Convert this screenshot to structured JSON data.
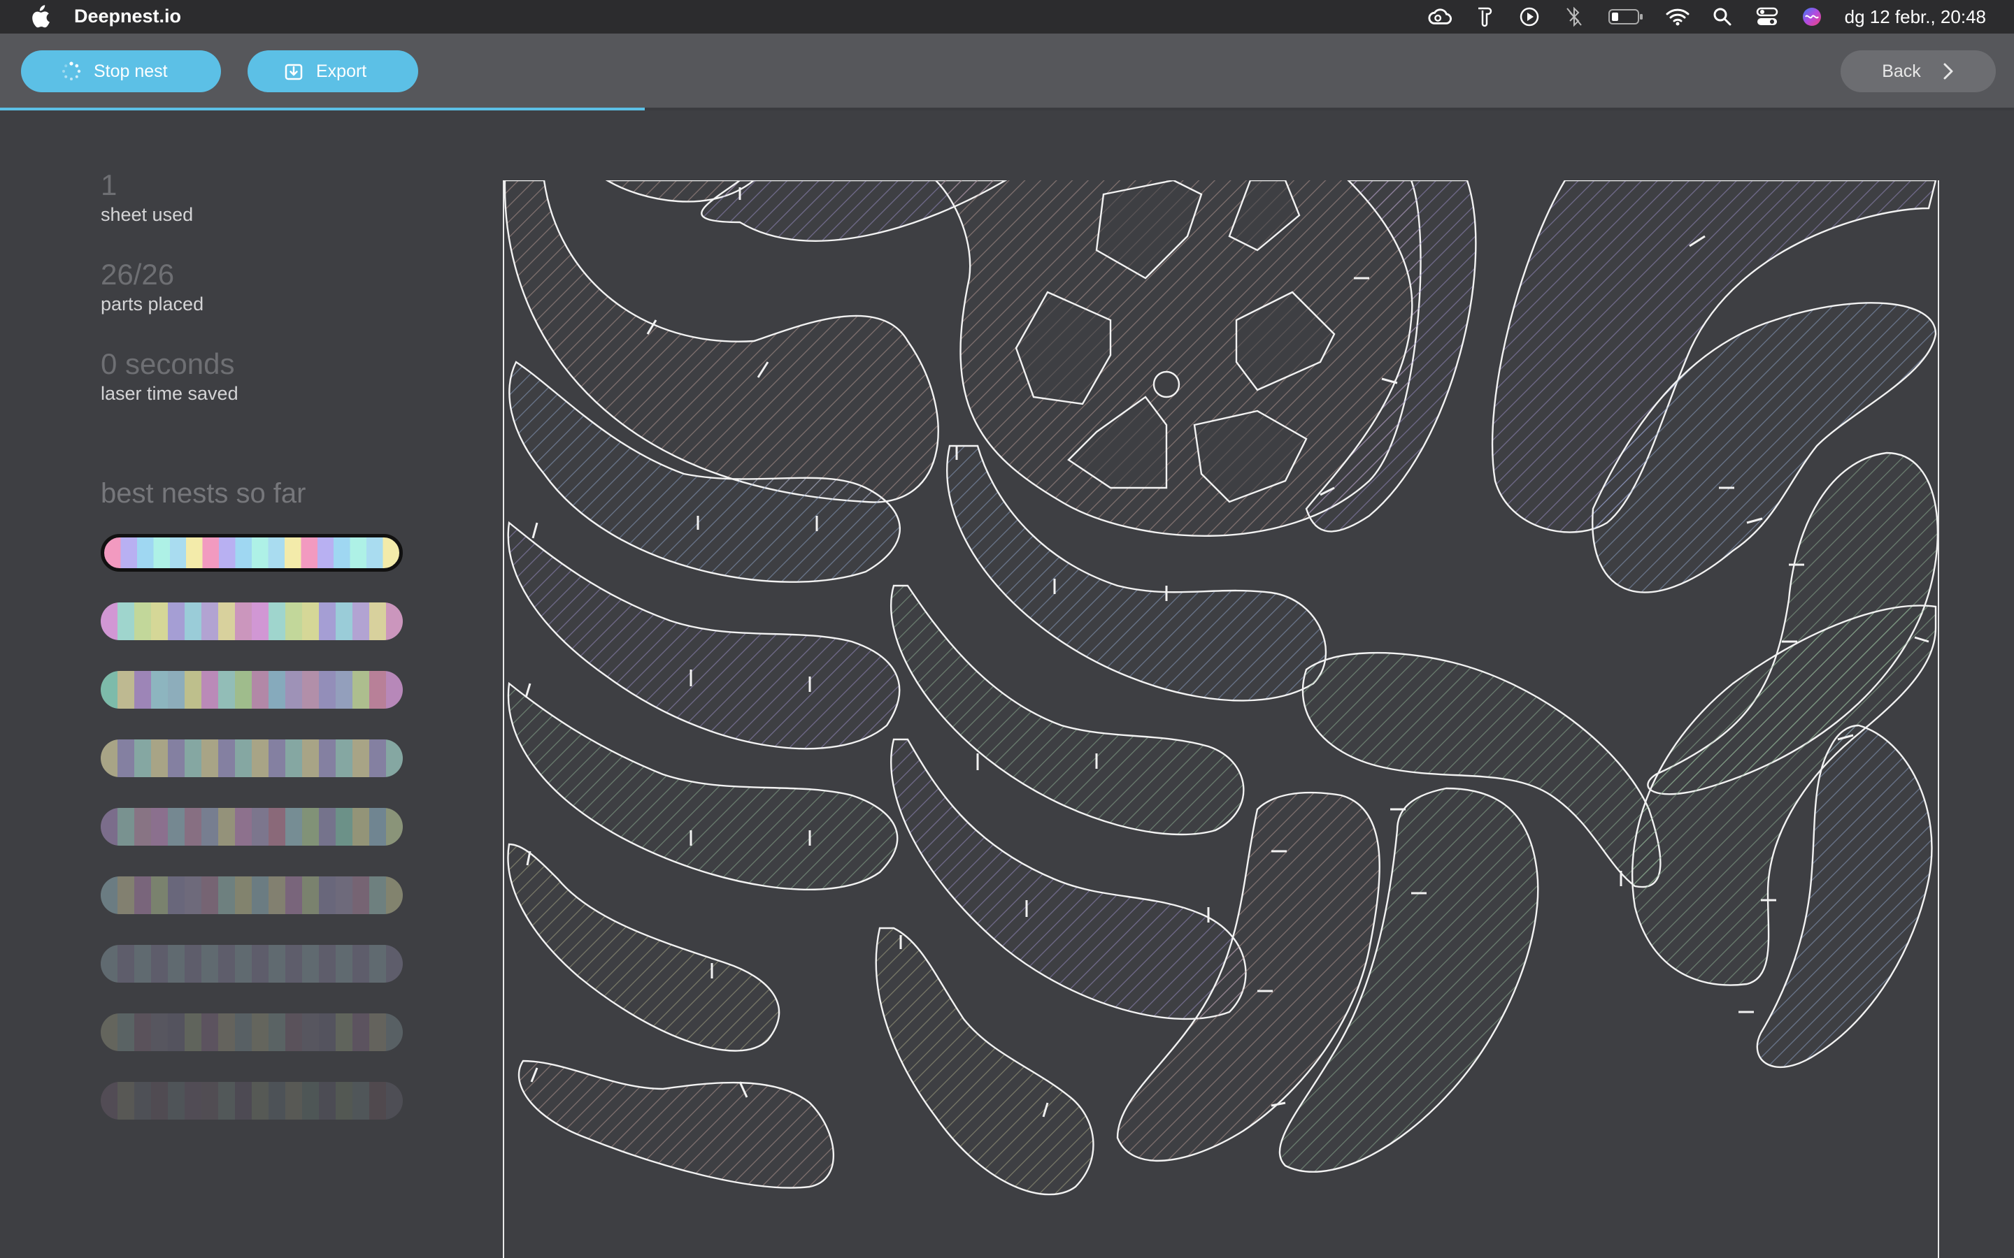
{
  "menubar": {
    "app_name": "Deepnest.io",
    "clock": "dg 12 febr., 20:48",
    "status_icons": [
      "creative-cloud-icon",
      "script-icon",
      "play-circle-icon",
      "bluetooth-off-icon",
      "battery-icon",
      "wifi-icon",
      "search-icon",
      "control-center-icon",
      "siri-icon"
    ]
  },
  "toolbar": {
    "stop_label": "Stop nest",
    "export_label": "Export",
    "back_label": "Back"
  },
  "progress": {
    "fraction": 0.32,
    "color": "#5cc0e6"
  },
  "stats": [
    {
      "value": "1",
      "label": "sheet used"
    },
    {
      "value": "26/26",
      "label": "parts placed"
    },
    {
      "value": "0 seconds",
      "label": "laser time saved"
    }
  ],
  "best_nests": {
    "title": "best nests so far",
    "selected_index": 0,
    "count": 9,
    "stripe_colors": [
      "#f29ac0",
      "#e7a6d6",
      "#c9a3f0",
      "#b8b0f2",
      "#f4a8f0",
      "#efa6f2",
      "#9fd7f2",
      "#a8e6f5",
      "#b4c7f4",
      "#aef1e6",
      "#8ff0d5",
      "#c8b5ef",
      "#a9dcf0",
      "#d8f2a6",
      "#c3f0a3",
      "#f3ebaa",
      "#e6b0d8",
      "#f0f2a2"
    ]
  },
  "colors": {
    "background": "#3e3f43",
    "toolbar": "#56575b",
    "accent": "#5cc0e6"
  }
}
